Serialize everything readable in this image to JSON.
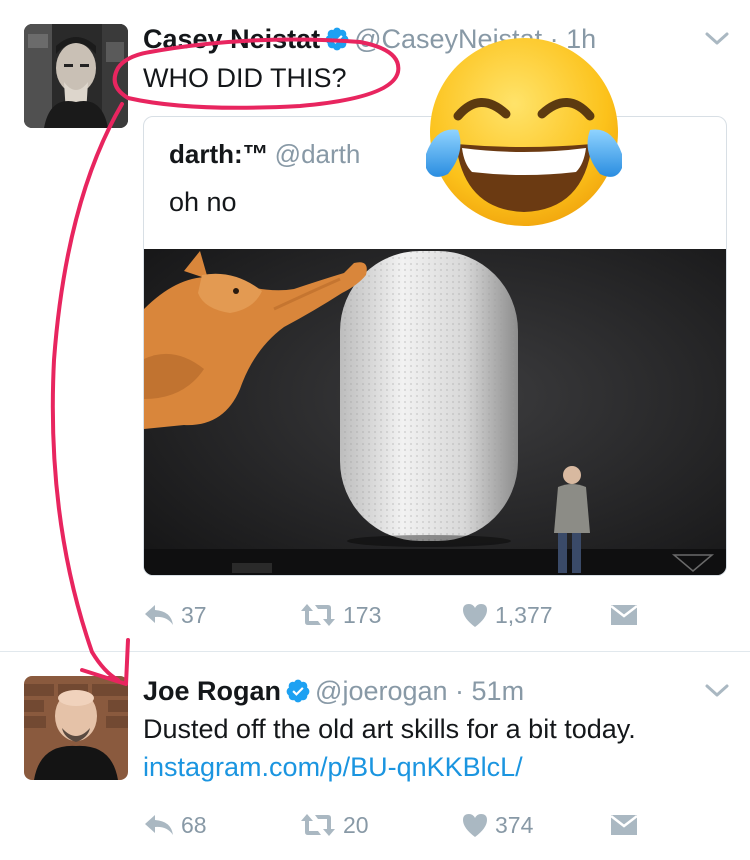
{
  "tweet1": {
    "name": "Casey Neistat",
    "handle": "@CaseyNeistat",
    "time": "1h",
    "text": "WHO DID THIS?",
    "quote": {
      "name": "darth:™",
      "handle": "@darth",
      "text": "oh no"
    },
    "replies": "37",
    "retweets": "173",
    "likes": "1,377"
  },
  "tweet2": {
    "name": "Joe Rogan",
    "handle": "@joerogan",
    "time": "51m",
    "text": "Dusted off the old art skills for a bit today.",
    "link": "instagram.com/p/BU-qnKKBlcL/",
    "replies": "68",
    "retweets": "20",
    "likes": "374"
  },
  "colors": {
    "name": "#14171a",
    "meta": "#8899a6",
    "link": "#1b95e0",
    "verified": "#1da1f2",
    "annotation": "#e8255f"
  },
  "icons": [
    "verified-icon",
    "chevron-down-icon",
    "reply-icon",
    "retweet-icon",
    "like-icon",
    "dm-icon",
    "tears-of-joy-emoji"
  ]
}
